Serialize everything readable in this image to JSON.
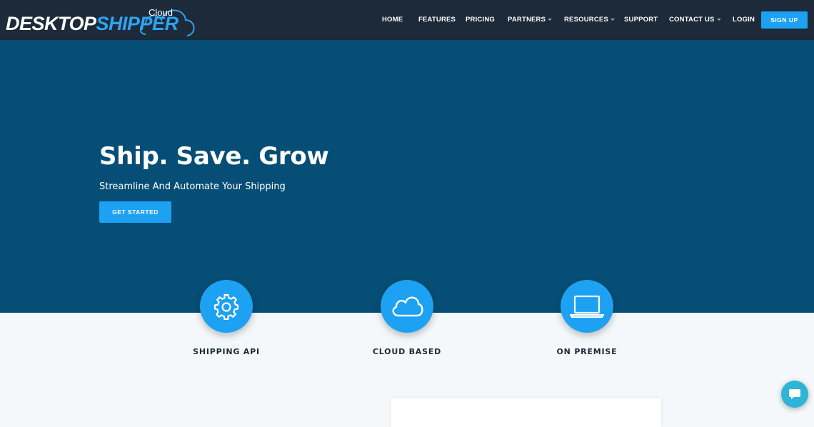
{
  "brand": {
    "logo_part1": "DESKTOP",
    "logo_part2": "SHIPPER",
    "logo_cloud": "Cloud",
    "accent_color": "#1da1f2",
    "nav_bg": "#1c2a39",
    "hero_bg": "#064e75"
  },
  "nav": {
    "items": [
      {
        "label": "HOME",
        "dropdown": false
      },
      {
        "label": "FEATURES",
        "dropdown": false
      },
      {
        "label": "PRICING",
        "dropdown": false
      },
      {
        "label": "PARTNERS",
        "dropdown": true
      },
      {
        "label": "RESOURCES",
        "dropdown": true
      },
      {
        "label": "SUPPORT",
        "dropdown": false
      },
      {
        "label": "CONTACT US",
        "dropdown": true
      },
      {
        "label": "LOGIN",
        "dropdown": false
      }
    ],
    "signup_label": "SIGN UP"
  },
  "hero": {
    "title": "Ship. Save. Grow",
    "subtitle": "Streamline And Automate Your Shipping",
    "cta_label": "GET STARTED"
  },
  "features": [
    {
      "label": "SHIPPING API",
      "icon": "gear-icon"
    },
    {
      "label": "CLOUD BASED",
      "icon": "cloud-icon"
    },
    {
      "label": "ON PREMISE",
      "icon": "laptop-icon"
    }
  ],
  "chat": {
    "icon": "chat-bubble-icon"
  }
}
